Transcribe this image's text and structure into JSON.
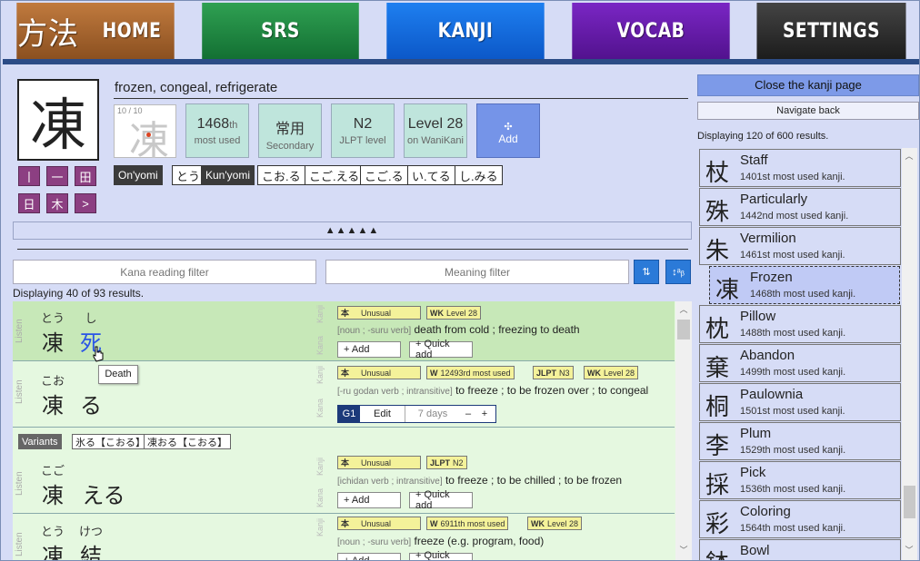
{
  "nav": {
    "logo_kanji": "方法",
    "home": "HOME",
    "srs": "SRS",
    "kanji": "KANJI",
    "vocab": "VOCAB",
    "settings": "SETTINGS"
  },
  "kanji": {
    "glyph": "凍",
    "meaning": "frozen, congeal, refrigerate",
    "stroke_counter": "10 / 10",
    "radicals": [
      "丨",
      "一",
      "田",
      "日",
      "木",
      ">"
    ],
    "stats": [
      {
        "value": "1468",
        "suffix": "th",
        "label": "most used"
      },
      {
        "value": "常用",
        "suffix": "",
        "label": "Secondary"
      },
      {
        "value": "N2",
        "suffix": "",
        "label": "JLPT level"
      },
      {
        "value": "Level 28",
        "suffix": "",
        "label": "on WaniKani"
      }
    ],
    "add_icon": "✣",
    "add_label": "Add",
    "onyomi_label": "On'yomi",
    "onyomi": [
      "とう"
    ],
    "kunyomi_label": "Kun'yomi",
    "kunyomi": [
      "こお.る",
      "こご.える",
      "こご.る",
      "い.てる",
      "し.みる"
    ],
    "collapse_text": "▲▲▲▲▲"
  },
  "filters": {
    "kana_placeholder": "Kana reading filter",
    "meaning_placeholder": "Meaning filter",
    "sort1": "⇅",
    "sort2": "↕ᵃᵦ",
    "displaying": "Displaying 40 of 93 results."
  },
  "vocab": {
    "listen_label": "Listen",
    "kanji_label": "Kanji",
    "kana_label": "Kana",
    "add_label": "+ Add",
    "quick_add_label": "+ Quick add",
    "rows": [
      {
        "chars": [
          {
            "f": "とう",
            "b": "凍"
          },
          {
            "f": "し",
            "b": "死"
          }
        ],
        "tags": [
          {
            "k": "本",
            "t": "Unusual"
          },
          {
            "k": "WK",
            "t": "Level 28"
          }
        ],
        "pos": "[noun ; -suru verb]",
        "gloss": "death from cold ; freezing to death"
      },
      {
        "chars": [
          {
            "f": "こお",
            "b": "凍"
          },
          {
            "f": "",
            "b": "る"
          }
        ],
        "tags": [
          {
            "k": "本",
            "t": "Unusual"
          },
          {
            "k": "W",
            "t": "12493rd most used"
          },
          {
            "k": "JLPT",
            "t": "N3"
          },
          {
            "k": "WK",
            "t": "Level 28"
          }
        ],
        "pos": "[-ru godan verb ; intransitive]",
        "gloss": "to freeze ; to be frozen over ; to congeal",
        "srs": {
          "group": "G1",
          "edit": "Edit",
          "days": "7 days",
          "minus": "–",
          "plus": "+"
        }
      },
      {
        "chars": [
          {
            "f": "こご",
            "b": "凍"
          },
          {
            "f": "",
            "b": "える"
          }
        ],
        "tags": [
          {
            "k": "本",
            "t": "Unusual"
          },
          {
            "k": "JLPT",
            "t": "N2"
          }
        ],
        "pos": "[ichidan verb ; intransitive]",
        "gloss": "to freeze ; to be chilled ; to be frozen"
      },
      {
        "chars": [
          {
            "f": "とう",
            "b": "凍"
          },
          {
            "f": "けつ",
            "b": "結"
          }
        ],
        "tags": [
          {
            "k": "本",
            "t": "Unusual"
          },
          {
            "k": "W",
            "t": "6911th most used"
          },
          {
            "k": "WK",
            "t": "Level 28"
          }
        ],
        "pos": "[noun ; -suru verb]",
        "gloss": "freeze (e.g. program, food)"
      }
    ],
    "variants_label": "Variants",
    "variants": [
      "氷る【こおる】",
      "凍おる【こおる】"
    ],
    "tooltip": "Death"
  },
  "right": {
    "close_label": "Close the kanji page",
    "back_label": "Navigate back",
    "displaying": "Displaying 120 of 600 results.",
    "items": [
      {
        "g": "杖",
        "n": "Staff",
        "s": "1401st most used kanji."
      },
      {
        "g": "殊",
        "n": "Particularly",
        "s": "1442nd most used kanji."
      },
      {
        "g": "朱",
        "n": "Vermilion",
        "s": "1461st most used kanji."
      },
      {
        "g": "凍",
        "n": "Frozen",
        "s": "1468th most used kanji.",
        "selected": true
      },
      {
        "g": "枕",
        "n": "Pillow",
        "s": "1488th most used kanji."
      },
      {
        "g": "棄",
        "n": "Abandon",
        "s": "1499th most used kanji."
      },
      {
        "g": "桐",
        "n": "Paulownia",
        "s": "1501st most used kanji."
      },
      {
        "g": "李",
        "n": "Plum",
        "s": "1529th most used kanji."
      },
      {
        "g": "採",
        "n": "Pick",
        "s": "1536th most used kanji."
      },
      {
        "g": "彩",
        "n": "Coloring",
        "s": "1564th most used kanji."
      },
      {
        "g": "鉢",
        "n": "Bowl",
        "s": ""
      }
    ]
  }
}
